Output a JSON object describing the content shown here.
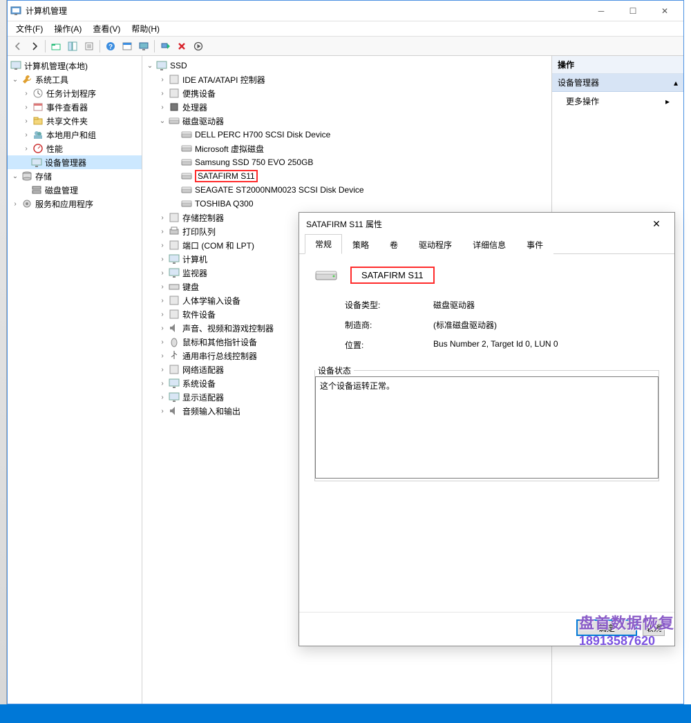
{
  "window": {
    "title": "计算机管理",
    "minimize": "─",
    "maximize": "☐",
    "close": "✕"
  },
  "menu": [
    "文件(F)",
    "操作(A)",
    "查看(V)",
    "帮助(H)"
  ],
  "leftTree": {
    "root": "计算机管理(本地)",
    "groups": [
      {
        "label": "系统工具",
        "children": [
          "任务计划程序",
          "事件查看器",
          "共享文件夹",
          "本地用户和组",
          "性能",
          "设备管理器"
        ]
      },
      {
        "label": "存储",
        "children": [
          "磁盘管理"
        ]
      },
      {
        "label": "服务和应用程序",
        "children": []
      }
    ],
    "selected": "设备管理器"
  },
  "centerTree": {
    "root": "SSD",
    "nodes": [
      {
        "label": "IDE ATA/ATAPI 控制器",
        "expanded": false
      },
      {
        "label": "便携设备",
        "expanded": false
      },
      {
        "label": "处理器",
        "expanded": false
      },
      {
        "label": "磁盘驱动器",
        "expanded": true,
        "children": [
          "DELL PERC H700 SCSI Disk Device",
          "Microsoft 虚拟磁盘",
          "Samsung SSD 750 EVO 250GB",
          "SATAFIRM   S11",
          "SEAGATE ST2000NM0023 SCSI Disk Device",
          "TOSHIBA Q300"
        ],
        "highlight": "SATAFIRM   S11"
      },
      {
        "label": "存储控制器",
        "expanded": false
      },
      {
        "label": "打印队列",
        "expanded": false
      },
      {
        "label": "端口 (COM 和 LPT)",
        "expanded": false
      },
      {
        "label": "计算机",
        "expanded": false
      },
      {
        "label": "监视器",
        "expanded": false
      },
      {
        "label": "键盘",
        "expanded": false
      },
      {
        "label": "人体学输入设备",
        "expanded": false
      },
      {
        "label": "软件设备",
        "expanded": false
      },
      {
        "label": "声音、视频和游戏控制器",
        "expanded": false
      },
      {
        "label": "鼠标和其他指针设备",
        "expanded": false
      },
      {
        "label": "通用串行总线控制器",
        "expanded": false
      },
      {
        "label": "网络适配器",
        "expanded": false
      },
      {
        "label": "系统设备",
        "expanded": false
      },
      {
        "label": "显示适配器",
        "expanded": false
      },
      {
        "label": "音频输入和输出",
        "expanded": false
      }
    ]
  },
  "actions": {
    "header": "操作",
    "section": "设备管理器",
    "moreActions": "更多操作"
  },
  "dialog": {
    "title": "SATAFIRM   S11 属性",
    "tabs": [
      "常规",
      "策略",
      "卷",
      "驱动程序",
      "详细信息",
      "事件"
    ],
    "activeTab": 0,
    "deviceName": "SATAFIRM   S11",
    "props": {
      "typeLabel": "设备类型:",
      "typeValue": "磁盘驱动器",
      "mfrLabel": "制造商:",
      "mfrValue": "(标准磁盘驱动器)",
      "locLabel": "位置:",
      "locValue": "Bus Number 2, Target Id 0, LUN 0"
    },
    "statusLabel": "设备状态",
    "statusText": "这个设备运转正常。",
    "okBtn": "确定",
    "cancelBtn": "取消"
  },
  "watermark": {
    "line1": "盘首数据恢复",
    "line2": "18913587620"
  }
}
